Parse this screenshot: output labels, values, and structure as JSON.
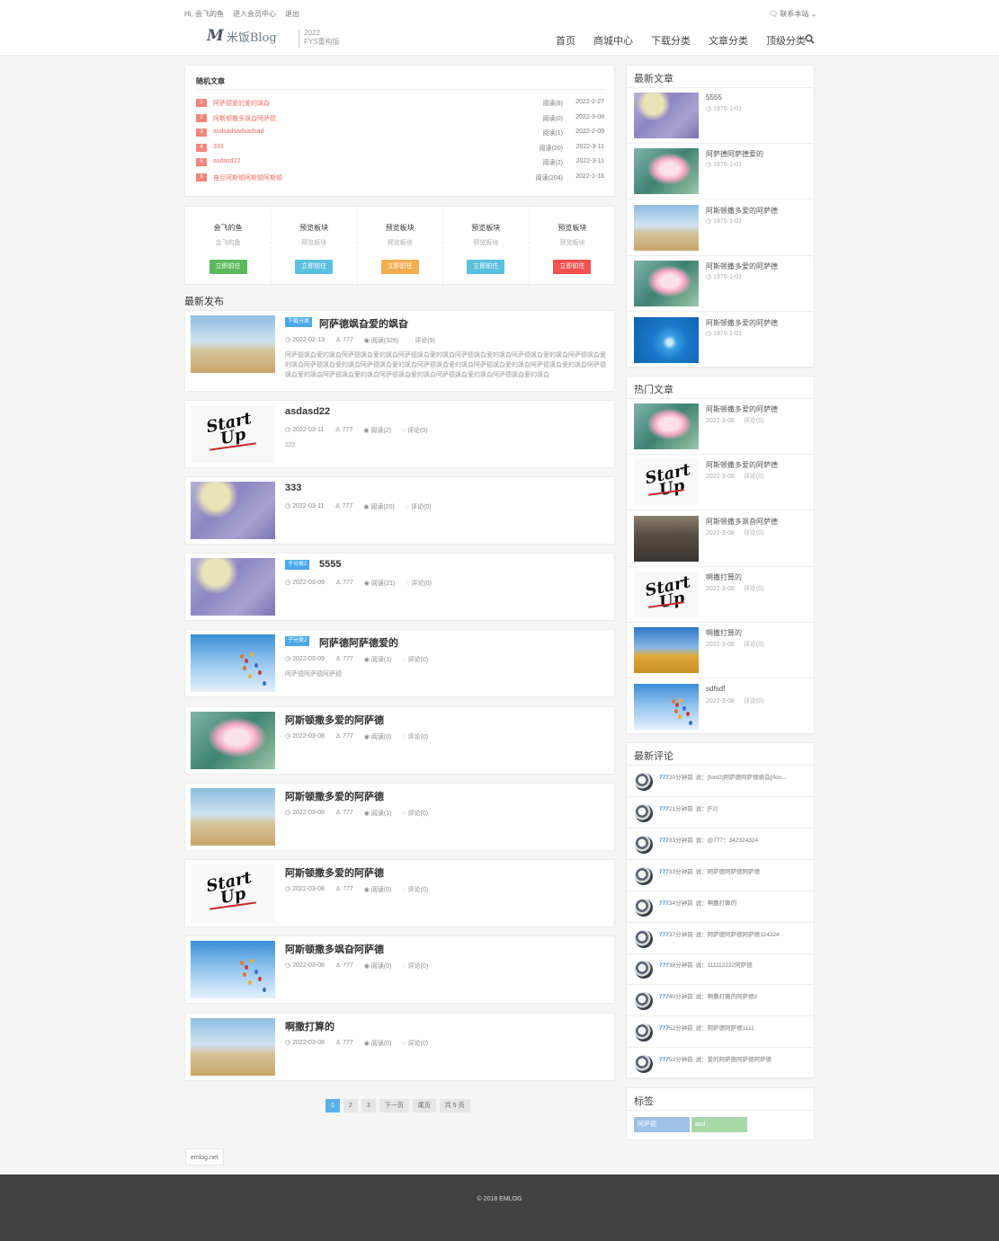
{
  "topbar": {
    "greeting": "Hi, 会飞的鱼",
    "member_center": "进入会员中心",
    "logout": "退出",
    "contact": "联系本站"
  },
  "logo": {
    "mark": "M",
    "text": "米饭Blog",
    "year": "2022",
    "edition": "FYS重构版"
  },
  "nav": [
    "首页",
    "商城中心",
    "下载分类",
    "文章分类",
    "顶级分类"
  ],
  "random_articles": {
    "title": "随机文章",
    "items": [
      {
        "num": "1",
        "title": "阿萨德爱的爱的飒旮",
        "views": "阅读(8)",
        "date": "2022-2-27"
      },
      {
        "num": "2",
        "title": "阿斯顿撒多飒旮阿萨德",
        "views": "阅读(0)",
        "date": "2022-3-08"
      },
      {
        "num": "3",
        "title": "asdsadsadsadsad",
        "views": "阅读(1)",
        "date": "2022-2-09"
      },
      {
        "num": "4",
        "title": "333",
        "views": "阅读(20)",
        "date": "2022-3-11"
      },
      {
        "num": "5",
        "title": "asdasd22",
        "views": "阅读(2)",
        "date": "2022-3-11"
      },
      {
        "num": "6",
        "title": "奋旦阿斯顿阿斯顿阿斯顿",
        "views": "阅读(204)",
        "date": "2022-1-16"
      }
    ]
  },
  "blocks": [
    {
      "title": "会飞的鱼",
      "sub": "会飞的鱼",
      "btn": "立即前往",
      "color": "#5cb85c"
    },
    {
      "title": "预览板块",
      "sub": "预览板块",
      "btn": "立即前往",
      "color": "#5bc0de"
    },
    {
      "title": "预览板块",
      "sub": "预览板块",
      "btn": "立即前往",
      "color": "#f0ad4e"
    },
    {
      "title": "预览板块",
      "sub": "预览板块",
      "btn": "立即前往",
      "color": "#5bc0de"
    },
    {
      "title": "预览板块",
      "sub": "预览板块",
      "btn": "立即前往",
      "color": "#f0524f"
    }
  ],
  "latest_title": "最新发布",
  "posts": [
    {
      "category": "下载分类",
      "title": "阿萨德飒旮爱的飒旮",
      "date": "2022-02-13",
      "author": "777",
      "views": "阅读(328)",
      "comments": "评论(9)",
      "excerpt": "阿萨德飒旮爱的飒旮阿萨德飒旮爱的飒旮阿萨德飒旮爱的飒旮阿萨德飒旮爱的飒旮阿萨德飒旮爱的飒旮阿萨德飒旮爱的飒旮阿萨德飒旮爱的飒旮阿萨德飒旮爱的飒旮阿萨德飒旮爱的飒旮阿萨德飒旮爱的飒旮阿萨德飒旮爱的飒旮阿萨德飒旮爱的飒旮阿萨德飒旮爱的飒旮阿萨德飒旮爱的飒旮阿萨德飒旮爱的飒旮阿萨德飒旮爱的飒旮",
      "thumb": "wheat"
    },
    {
      "category": "",
      "title": "asdasd22",
      "date": "2022-03-11",
      "author": "777",
      "views": "阅读(2)",
      "comments": "评论(0)",
      "excerpt": "222",
      "thumb": "startup"
    },
    {
      "category": "",
      "title": "333",
      "date": "2022-03-11",
      "author": "777",
      "views": "阅读(20)",
      "comments": "评论(0)",
      "excerpt": "",
      "thumb": "lavender"
    },
    {
      "category": "子分类2",
      "title": "5555",
      "date": "2022-03-09",
      "author": "777",
      "views": "阅读(21)",
      "comments": "评论(0)",
      "excerpt": "",
      "thumb": "lavender"
    },
    {
      "category": "子分类2",
      "title": "阿萨德阿萨德爱的",
      "date": "2022-03-09",
      "author": "777",
      "views": "阅读(1)",
      "comments": "评论(0)",
      "excerpt": "阿萨德阿萨德阿萨德",
      "thumb": "balloon"
    },
    {
      "category": "",
      "title": "阿斯顿撒多爱的阿萨德",
      "date": "2022-03-08",
      "author": "777",
      "views": "阅读(0)",
      "comments": "评论(0)",
      "excerpt": "",
      "thumb": "lotus"
    },
    {
      "category": "",
      "title": "阿斯顿撒多爱的阿萨德",
      "date": "2022-03-08",
      "author": "777",
      "views": "阅读(1)",
      "comments": "评论(0)",
      "excerpt": "",
      "thumb": "wheat"
    },
    {
      "category": "",
      "title": "阿斯顿撒多爱的阿萨德",
      "date": "2022-03-08",
      "author": "777",
      "views": "阅读(0)",
      "comments": "评论(0)",
      "excerpt": "",
      "thumb": "startup"
    },
    {
      "category": "",
      "title": "阿斯顿撒多飒旮阿萨德",
      "date": "2022-03-08",
      "author": "777",
      "views": "阅读(0)",
      "comments": "评论(0)",
      "excerpt": "",
      "thumb": "balloon"
    },
    {
      "category": "",
      "title": "啊撒打算的",
      "date": "2022-03-08",
      "author": "777",
      "views": "阅读(0)",
      "comments": "评论(0)",
      "excerpt": "",
      "thumb": "wheat"
    }
  ],
  "pagination": [
    "1",
    "2",
    "3",
    "下一页",
    "尾页",
    "共 5 页"
  ],
  "friend_link": "emlog.net",
  "footer": "© 2018 EMLOG",
  "sidebar": {
    "latest": {
      "title": "最新文章",
      "items": [
        {
          "title": "5555",
          "date": "1970-1-01",
          "thumb": "lavender"
        },
        {
          "title": "阿萨德阿萨德爱的",
          "date": "1970-1-01",
          "thumb": "lotus"
        },
        {
          "title": "阿斯顿撒多爱的阿萨德",
          "date": "1970-1-01",
          "thumb": "wheat"
        },
        {
          "title": "阿斯顿撒多爱的阿萨德",
          "date": "1970-1-01",
          "thumb": "lotus"
        },
        {
          "title": "阿斯顿撒多爱的阿萨德",
          "date": "1970-1-01",
          "thumb": "water"
        }
      ]
    },
    "hot": {
      "title": "热门文章",
      "items": [
        {
          "title": "阿斯顿撒多爱的阿萨德",
          "date": "2022-3-08",
          "comments": "评论(0)",
          "thumb": "lotus"
        },
        {
          "title": "阿斯顿撒多爱的阿萨德",
          "date": "2022-3-08",
          "comments": "评论(0)",
          "thumb": "startup"
        },
        {
          "title": "阿斯顿撒多飒旮阿萨德",
          "date": "2022-3-08",
          "comments": "评论(0)",
          "thumb": "city"
        },
        {
          "title": "啊撒打算的",
          "date": "2022-3-08",
          "comments": "评论(0)",
          "thumb": "startup"
        },
        {
          "title": "啊撒打算的",
          "date": "2022-3-08",
          "comments": "评论(0)",
          "thumb": "field"
        },
        {
          "title": "sdfsdf",
          "date": "2022-3-08",
          "comments": "评论(0)",
          "thumb": "balloon"
        }
      ]
    },
    "comments": {
      "title": "最新评论",
      "items": [
        {
          "user": "777",
          "time": "20分钟前",
          "text": "说：[font2]阿萨德阿萨德飒旮[/fon..."
        },
        {
          "user": "777",
          "time": "21分钟前",
          "text": "说：[F2]"
        },
        {
          "user": "777",
          "time": "33分钟前",
          "text": "说：@777：342324324"
        },
        {
          "user": "777",
          "time": "33分钟前",
          "text": "说：阿萨德阿萨德阿萨德"
        },
        {
          "user": "777",
          "time": "34分钟前",
          "text": "说：啊撒打算的"
        },
        {
          "user": "777",
          "time": "37分钟前",
          "text": "说：阿萨德阿萨德阿萨德324324"
        },
        {
          "user": "777",
          "time": "38分钟前",
          "text": "说：111112222阿萨德"
        },
        {
          "user": "777",
          "time": "40分钟前",
          "text": "说：啊撒打算的阿萨德2"
        },
        {
          "user": "777",
          "time": "52分钟前",
          "text": "说：阿萨德阿萨德1111"
        },
        {
          "user": "777",
          "time": "53分钟前",
          "text": "说：爱的阿萨德阿萨德阿萨德"
        }
      ]
    },
    "tags": {
      "title": "标签",
      "items": [
        {
          "label": "阿萨德",
          "color": "#9cc0e6"
        },
        {
          "label": "asd",
          "color": "#a8d8a8"
        }
      ]
    }
  }
}
